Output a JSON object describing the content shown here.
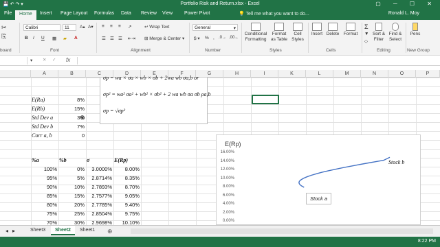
{
  "window": {
    "title": "Portfolio Risk and Return.xlsx - Excel",
    "user": "Ronald L. Moy",
    "tell_me": "Tell me what you want to do..."
  },
  "ribbon_tabs": [
    "File",
    "Home",
    "Insert",
    "Page Layout",
    "Formulas",
    "Data",
    "Review",
    "View",
    "Power Pivot"
  ],
  "ribbon": {
    "font_name": "Calibri",
    "font_size": "11",
    "wrap_text": "Wrap Text",
    "merge_center": "Merge & Center",
    "number_format": "General",
    "conditional_formatting": "Conditional Formatting",
    "format_as_table": "Format as Table",
    "cell_styles": "Cell Styles",
    "insert": "Insert",
    "delete": "Delete",
    "format": "Format",
    "sort_filter": "Sort & Filter",
    "find_select": "Find & Select",
    "pens": "Pens",
    "groups": {
      "clipboard": "board",
      "font": "Font",
      "alignment": "Alignment",
      "number": "Number",
      "styles": "Styles",
      "cells": "Cells",
      "editing": "Editing",
      "new_group": "New Group"
    }
  },
  "formula_bar": {
    "name_box": "",
    "fx": "fx"
  },
  "columns": [
    "A",
    "B",
    "C",
    "D",
    "E",
    "F",
    "G",
    "H",
    "I",
    "J",
    "K",
    "L",
    "M",
    "N",
    "O",
    "P"
  ],
  "selected_column": "J",
  "equations": {
    "line1": "σp = wa × σa × wb × σb + 2wa wb σa,b  or",
    "line2": "σp² = wa² σa² + wb² × σb² + 2 wa wb σa σb ρa,b",
    "line3": "σp = √σp²"
  },
  "stats": [
    {
      "label": "E(Ra)",
      "value": "8%"
    },
    {
      "label": "E(Rb)",
      "value": "15%"
    },
    {
      "label": "Std Dev a",
      "value": "3%"
    },
    {
      "label": "Std Dev b",
      "value": "7%"
    },
    {
      "label": "Corr a, b",
      "value": "0"
    }
  ],
  "table": {
    "headers": [
      "%a",
      "%b",
      "σ",
      "E(Rp)"
    ],
    "rows": [
      [
        "100%",
        "0%",
        "3.0000%",
        "8.00%"
      ],
      [
        "95%",
        "5%",
        "2.8714%",
        "8.35%"
      ],
      [
        "90%",
        "10%",
        "2.7893%",
        "8.70%"
      ],
      [
        "85%",
        "15%",
        "2.7577%",
        "9.05%"
      ],
      [
        "80%",
        "20%",
        "2.7785%",
        "9.40%"
      ],
      [
        "75%",
        "25%",
        "2.8504%",
        "9.75%"
      ],
      [
        "70%",
        "30%",
        "2.9698%",
        "10.10%"
      ]
    ]
  },
  "chart_data": {
    "type": "line",
    "title": "E(Rp)",
    "ylim": [
      0,
      16
    ],
    "yticks": [
      "16.00%",
      "14.00%",
      "12.00%",
      "10.00%",
      "8.00%",
      "6.00%",
      "4.00%",
      "2.00%",
      "0.00%"
    ],
    "series": [
      {
        "x": [
          3.0,
          2.8714,
          2.7893,
          2.7577,
          2.7785,
          2.8504,
          2.9698,
          3.132,
          3.3327,
          3.5681,
          3.8341,
          4.1278,
          4.4467,
          4.7865,
          5.1447,
          5.5191,
          5.9066,
          6.3067,
          6.7148,
          7.0
        ],
        "y": [
          8.0,
          8.35,
          8.7,
          9.05,
          9.4,
          9.75,
          10.1,
          10.45,
          10.8,
          11.15,
          11.5,
          11.85,
          12.2,
          12.55,
          12.9,
          13.25,
          13.6,
          13.95,
          14.3,
          15.0
        ],
        "color": "#4472c4"
      }
    ],
    "annotations": {
      "stock_a": "Stock a",
      "stock_b": "Stock b"
    }
  },
  "sheets": [
    "Sheet3",
    "Sheet2",
    "Sheet1"
  ],
  "active_sheet": "Sheet2",
  "status": {
    "ready": "",
    "clock": "8:22 PM"
  }
}
